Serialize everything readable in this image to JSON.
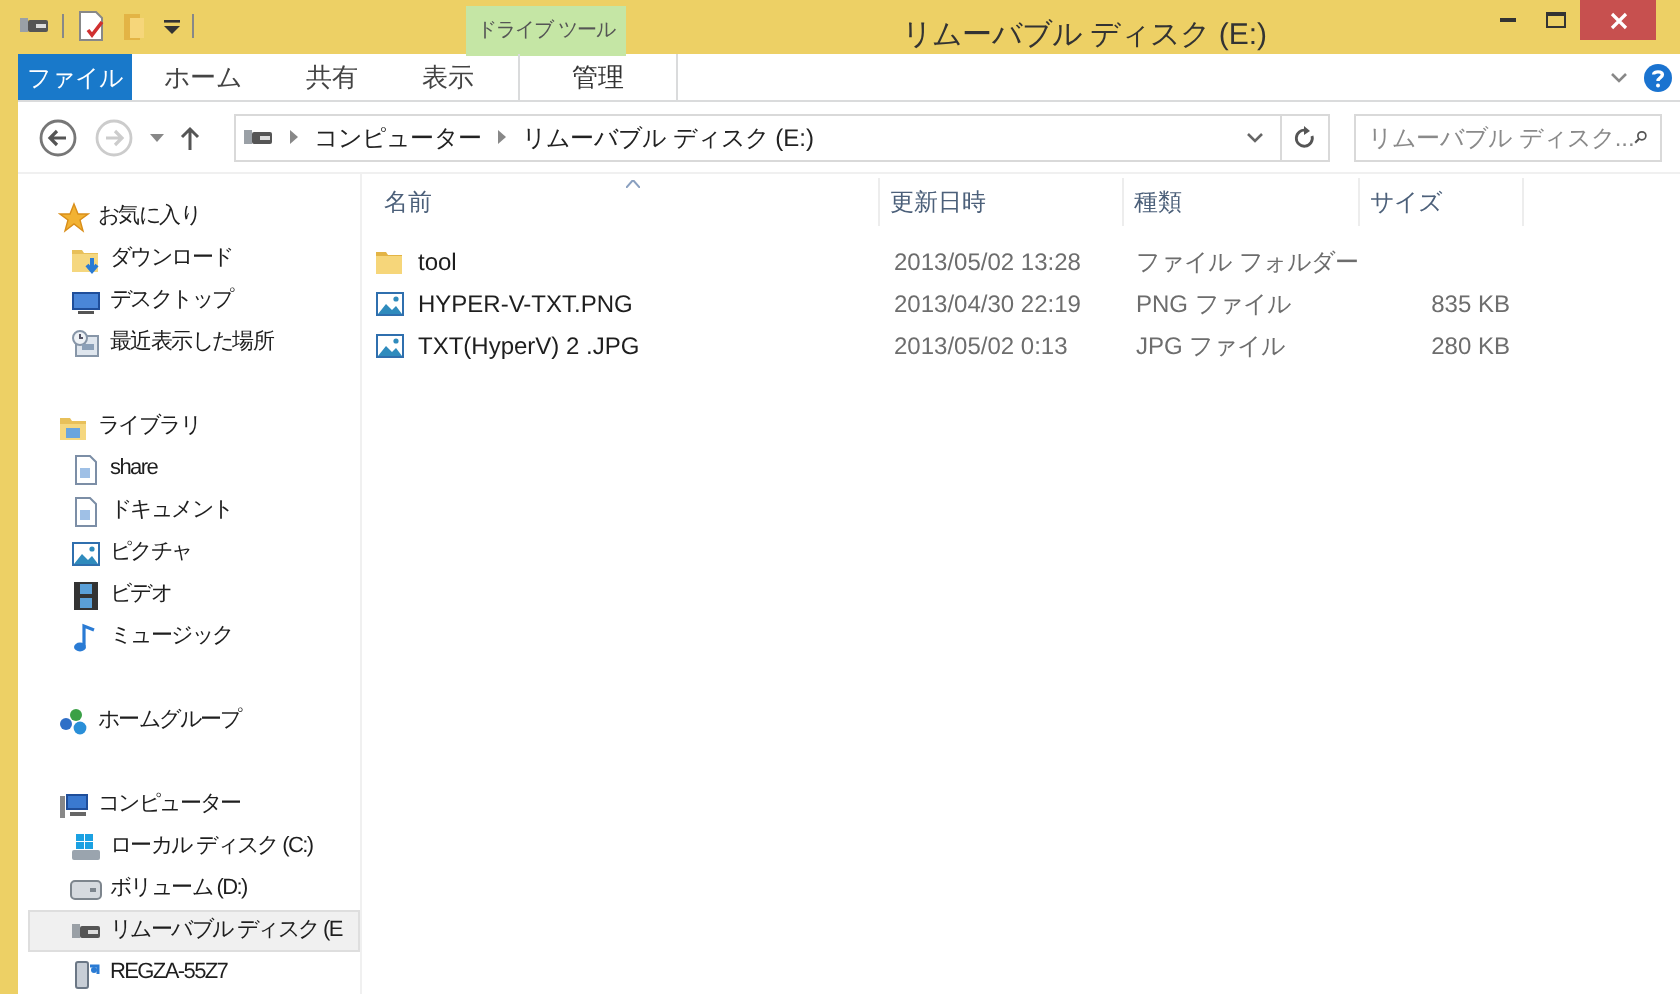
{
  "window": {
    "title": "リムーバブル ディスク (E:)",
    "context_group": "ドライブ ツール"
  },
  "ribbon_tabs": [
    {
      "label": "ファイル",
      "kind": "file",
      "selected": false
    },
    {
      "label": "ホーム",
      "kind": "normal",
      "selected": false
    },
    {
      "label": "共有",
      "kind": "normal",
      "selected": false
    },
    {
      "label": "表示",
      "kind": "normal",
      "selected": false
    },
    {
      "label": "管理",
      "kind": "context",
      "selected": false
    }
  ],
  "address": {
    "breadcrumbs": [
      "コンピューター",
      "リムーバブル ディスク (E:)"
    ]
  },
  "search": {
    "placeholder": "リムーバブル ディスク..."
  },
  "navigation": [
    {
      "label": "お気に入り",
      "children": [
        {
          "label": "ダウンロード",
          "selected": false
        },
        {
          "label": "デスクトップ",
          "selected": false
        },
        {
          "label": "最近表示した場所",
          "selected": false
        }
      ]
    },
    {
      "label": "ライブラリ",
      "children": [
        {
          "label": "share",
          "selected": false
        },
        {
          "label": "ドキュメント",
          "selected": false
        },
        {
          "label": "ピクチャ",
          "selected": false
        },
        {
          "label": "ビデオ",
          "selected": false
        },
        {
          "label": "ミュージック",
          "selected": false
        }
      ]
    },
    {
      "label": "ホームグループ"
    },
    {
      "label": "コンピューター",
      "children": [
        {
          "label": "ローカル ディスク (C:)",
          "selected": false
        },
        {
          "label": "ボリューム (D:)",
          "selected": false
        },
        {
          "label": "リムーバブル ディスク (E",
          "selected": true
        },
        {
          "label": "REGZA-55Z7",
          "selected": false
        }
      ]
    }
  ],
  "table": {
    "columns": [
      {
        "label": "名前",
        "sorted": true
      },
      {
        "label": "更新日時",
        "sorted": false
      },
      {
        "label": "種類",
        "sorted": false
      },
      {
        "label": "サイズ",
        "sorted": false
      }
    ],
    "rows": [
      {
        "name": "tool",
        "kind": "folder",
        "date": "2013/05/02 13:28",
        "type": "ファイル フォルダー"
      },
      {
        "name": "HYPER-V-TXT.PNG",
        "kind": "image",
        "date": "2013/04/30 22:19",
        "type": "PNG ファイル",
        "size": "835 KB"
      },
      {
        "name": "TXT(HyperV) 2 .JPG",
        "kind": "image",
        "date": "2013/05/02 0:13",
        "type": "JPG ファイル",
        "size": "280 KB"
      }
    ]
  }
}
